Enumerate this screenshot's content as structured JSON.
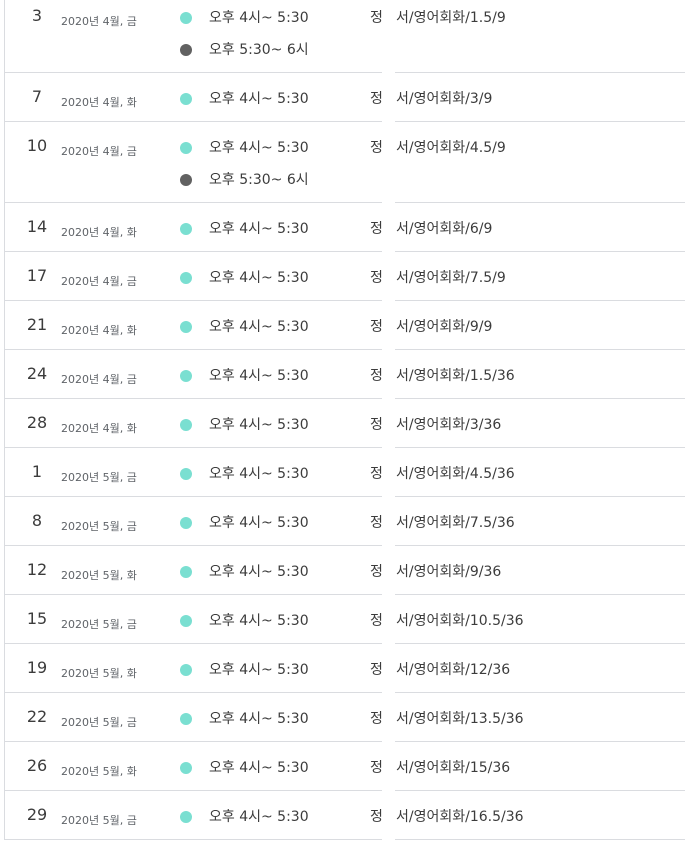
{
  "colors": {
    "dot_primary": "#7adfd1",
    "dot_secondary": "#616161"
  },
  "days": [
    {
      "day": "3",
      "date": "2020년 4월, 금",
      "events": [
        {
          "time": "오후 4시~ 5:30",
          "color": "dot_primary",
          "label": "정",
          "title": "서/영어회화/1.5/9"
        },
        {
          "time": "오후 5:30~ 6시",
          "color": "dot_secondary",
          "label": "",
          "title": ""
        }
      ]
    },
    {
      "day": "7",
      "date": "2020년 4월, 화",
      "events": [
        {
          "time": "오후 4시~ 5:30",
          "color": "dot_primary",
          "label": "정",
          "title": "서/영어회화/3/9"
        }
      ]
    },
    {
      "day": "10",
      "date": "2020년 4월, 금",
      "events": [
        {
          "time": "오후 4시~ 5:30",
          "color": "dot_primary",
          "label": "정",
          "title": "서/영어회화/4.5/9"
        },
        {
          "time": "오후 5:30~ 6시",
          "color": "dot_secondary",
          "label": "",
          "title": ""
        }
      ]
    },
    {
      "day": "14",
      "date": "2020년 4월, 화",
      "events": [
        {
          "time": "오후 4시~ 5:30",
          "color": "dot_primary",
          "label": "정",
          "title": "서/영어회화/6/9"
        }
      ]
    },
    {
      "day": "17",
      "date": "2020년 4월, 금",
      "events": [
        {
          "time": "오후 4시~ 5:30",
          "color": "dot_primary",
          "label": "정",
          "title": "서/영어회화/7.5/9"
        }
      ]
    },
    {
      "day": "21",
      "date": "2020년 4월, 화",
      "events": [
        {
          "time": "오후 4시~ 5:30",
          "color": "dot_primary",
          "label": "정",
          "title": "서/영어회화/9/9"
        }
      ]
    },
    {
      "day": "24",
      "date": "2020년 4월, 금",
      "events": [
        {
          "time": "오후 4시~ 5:30",
          "color": "dot_primary",
          "label": "정",
          "title": "서/영어회화/1.5/36"
        }
      ]
    },
    {
      "day": "28",
      "date": "2020년 4월, 화",
      "events": [
        {
          "time": "오후 4시~ 5:30",
          "color": "dot_primary",
          "label": "정",
          "title": "서/영어회화/3/36"
        }
      ]
    },
    {
      "day": "1",
      "date": "2020년 5월, 금",
      "events": [
        {
          "time": "오후 4시~ 5:30",
          "color": "dot_primary",
          "label": "정",
          "title": "서/영어회화/4.5/36"
        }
      ]
    },
    {
      "day": "8",
      "date": "2020년 5월, 금",
      "events": [
        {
          "time": "오후 4시~ 5:30",
          "color": "dot_primary",
          "label": "정",
          "title": "서/영어회화/7.5/36"
        }
      ]
    },
    {
      "day": "12",
      "date": "2020년 5월, 화",
      "events": [
        {
          "time": "오후 4시~ 5:30",
          "color": "dot_primary",
          "label": "정",
          "title": "서/영어회화/9/36"
        }
      ]
    },
    {
      "day": "15",
      "date": "2020년 5월, 금",
      "events": [
        {
          "time": "오후 4시~ 5:30",
          "color": "dot_primary",
          "label": "정",
          "title": "서/영어회화/10.5/36"
        }
      ]
    },
    {
      "day": "19",
      "date": "2020년 5월, 화",
      "events": [
        {
          "time": "오후 4시~ 5:30",
          "color": "dot_primary",
          "label": "정",
          "title": "서/영어회화/12/36"
        }
      ]
    },
    {
      "day": "22",
      "date": "2020년 5월, 금",
      "events": [
        {
          "time": "오후 4시~ 5:30",
          "color": "dot_primary",
          "label": "정",
          "title": "서/영어회화/13.5/36"
        }
      ]
    },
    {
      "day": "26",
      "date": "2020년 5월, 화",
      "events": [
        {
          "time": "오후 4시~ 5:30",
          "color": "dot_primary",
          "label": "정",
          "title": "서/영어회화/15/36"
        }
      ]
    },
    {
      "day": "29",
      "date": "2020년 5월, 금",
      "events": [
        {
          "time": "오후 4시~ 5:30",
          "color": "dot_primary",
          "label": "정",
          "title": "서/영어회화/16.5/36"
        }
      ]
    }
  ]
}
